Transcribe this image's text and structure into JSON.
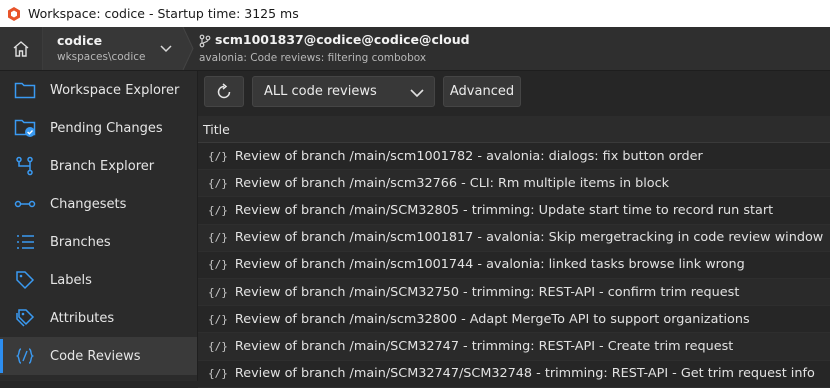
{
  "window": {
    "title": "Workspace: codice - Startup time: 3125 ms"
  },
  "workspace": {
    "name": "codice",
    "path": "wkspaces\\codice"
  },
  "repository": {
    "title": "scm1001837@codice@codice@cloud",
    "subtitle": "avalonia: Code reviews: filtering combobox"
  },
  "sidebar": {
    "items": [
      {
        "label": "Workspace Explorer",
        "icon": "folder-icon"
      },
      {
        "label": "Pending Changes",
        "icon": "pending-changes-icon"
      },
      {
        "label": "Branch Explorer",
        "icon": "branch-explorer-icon"
      },
      {
        "label": "Changesets",
        "icon": "changeset-icon"
      },
      {
        "label": "Branches",
        "icon": "branches-list-icon"
      },
      {
        "label": "Labels",
        "icon": "label-icon"
      },
      {
        "label": "Attributes",
        "icon": "attributes-icon"
      },
      {
        "label": "Code Reviews",
        "icon": "code-review-icon",
        "active": true
      }
    ]
  },
  "toolbar": {
    "filter_selected": "ALL code reviews",
    "advanced_label": "Advanced"
  },
  "table": {
    "column_title": "Title",
    "row_icon": "{/}",
    "rows": [
      "Review of branch /main/scm1001782 - avalonia: dialogs: fix button order",
      "Review of branch /main/scm32766 - CLI: Rm multiple items in block",
      "Review of branch /main/SCM32805 - trimming: Update start time to record run start",
      "Review of branch /main/scm1001817 - avalonia: Skip mergetracking in code review window",
      "Review of branch /main/scm1001744 - avalonia: linked tasks browse link wrong",
      "Review of branch /main/SCM32750 - trimming: REST-API - confirm trim request",
      "Review of branch /main/scm32800 -  Adapt MergeTo API to support organizations",
      "Review of branch /main/SCM32747 - trimming: REST-API - Create trim request",
      "Review of branch /main/SCM32747/SCM32748 - trimming: REST-API - Get trim request info"
    ]
  },
  "colors": {
    "accent": "#2d8ef0",
    "app_icon": "#e8542a"
  }
}
